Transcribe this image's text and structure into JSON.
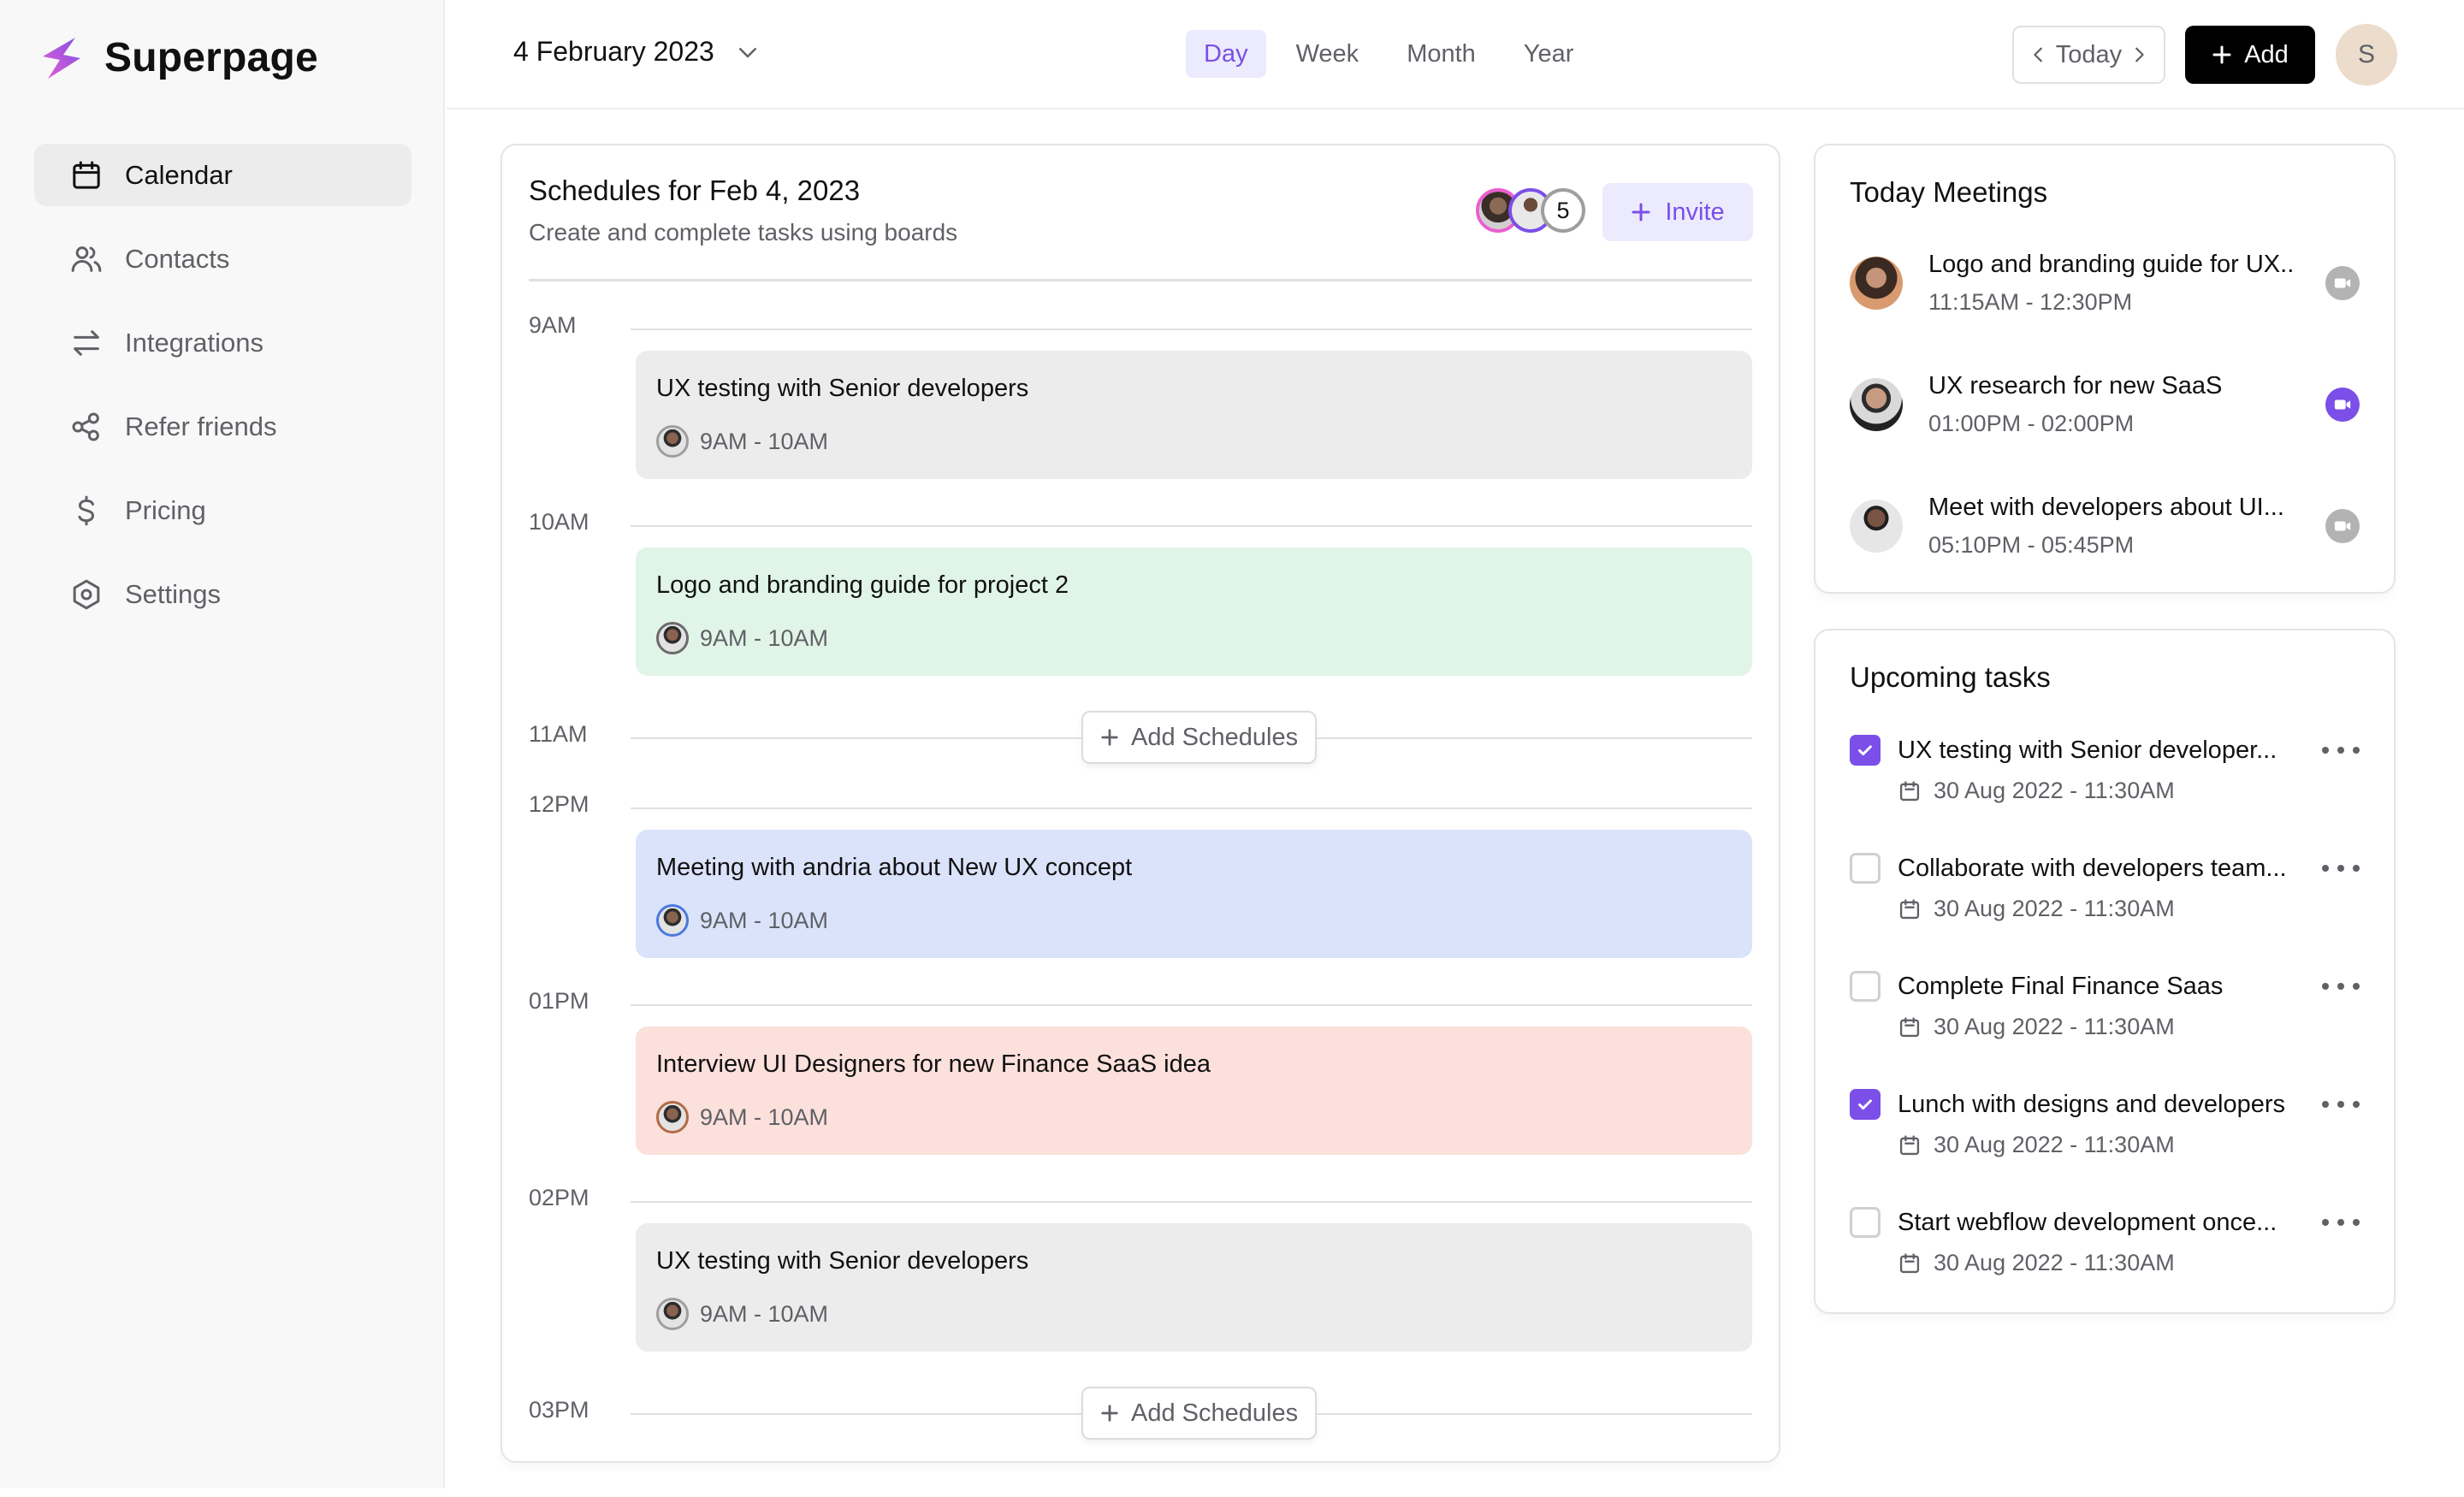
{
  "app": {
    "name": "Superpage",
    "colors": {
      "accent": "#7b4fe8",
      "logo_pink": "#ea5fd0",
      "logo_purple": "#7b4fe8"
    }
  },
  "sidebar": {
    "items": [
      {
        "label": "Calendar",
        "icon": "calendar-icon",
        "active": true
      },
      {
        "label": "Contacts",
        "icon": "users-icon",
        "active": false
      },
      {
        "label": "Integrations",
        "icon": "arrows-exchange-icon",
        "active": false
      },
      {
        "label": "Refer friends",
        "icon": "share-icon",
        "active": false
      },
      {
        "label": "Pricing",
        "icon": "dollar-icon",
        "active": false
      },
      {
        "label": "Settings",
        "icon": "settings-icon",
        "active": false
      }
    ]
  },
  "header": {
    "date": "4 February 2023",
    "views": [
      {
        "label": "Day",
        "active": true
      },
      {
        "label": "Week",
        "active": false
      },
      {
        "label": "Month",
        "active": false
      },
      {
        "label": "Year",
        "active": false
      }
    ],
    "today_label": "Today",
    "add_label": "Add",
    "user_initial": "S"
  },
  "schedule": {
    "title": "Schedules for Feb 4, 2023",
    "subtitle": "Create and complete tasks using boards",
    "participants_extra_count": "5",
    "invite_label": "Invite",
    "hours": [
      "9AM",
      "10AM",
      "11AM",
      "12PM",
      "01PM",
      "02PM",
      "03PM"
    ],
    "events": [
      {
        "title": "UX testing with Senior developers",
        "time": "9AM - 10AM",
        "color": "#ececec",
        "avatar_ring": "#9e9e9e"
      },
      {
        "title": "Logo and branding guide for project 2",
        "time": "9AM - 10AM",
        "color": "#e0f4e8",
        "avatar_ring": "#6b6b6b"
      },
      {
        "title": "Meeting with andria about New UX concept",
        "time": "9AM - 10AM",
        "color": "#dbe3fb",
        "avatar_ring": "#4a78e0"
      },
      {
        "title": "Interview UI Designers for new Finance SaaS idea",
        "time": "9AM - 10AM",
        "color": "#fbe0db",
        "avatar_ring": "#b36a45"
      },
      {
        "title": "UX testing with Senior developers",
        "time": "9AM - 10AM",
        "color": "#ececec",
        "avatar_ring": "#9e9e9e"
      }
    ],
    "add_schedules_label": "Add Schedules"
  },
  "meetings": {
    "title": "Today Meetings",
    "items": [
      {
        "title": "Logo and branding guide for UX..",
        "time": "11:15AM - 12:30PM",
        "video_active": false
      },
      {
        "title": "UX research for new SaaS",
        "time": "01:00PM - 02:00PM",
        "video_active": true
      },
      {
        "title": "Meet with developers about UI...",
        "time": "05:10PM - 05:45PM",
        "video_active": false
      }
    ]
  },
  "tasks": {
    "title": "Upcoming tasks",
    "items": [
      {
        "title": "UX testing with Senior developer...",
        "date": "30 Aug 2022 - 11:30AM",
        "checked": true
      },
      {
        "title": "Collaborate with developers team...",
        "date": "30 Aug 2022 - 11:30AM",
        "checked": false
      },
      {
        "title": "Complete Final Finance Saas",
        "date": "30 Aug 2022 - 11:30AM",
        "checked": false
      },
      {
        "title": "Lunch with designs and developers",
        "date": "30 Aug 2022 - 11:30AM",
        "checked": true
      },
      {
        "title": "Start webflow development once...",
        "date": "30 Aug 2022 - 11:30AM",
        "checked": false
      }
    ]
  }
}
